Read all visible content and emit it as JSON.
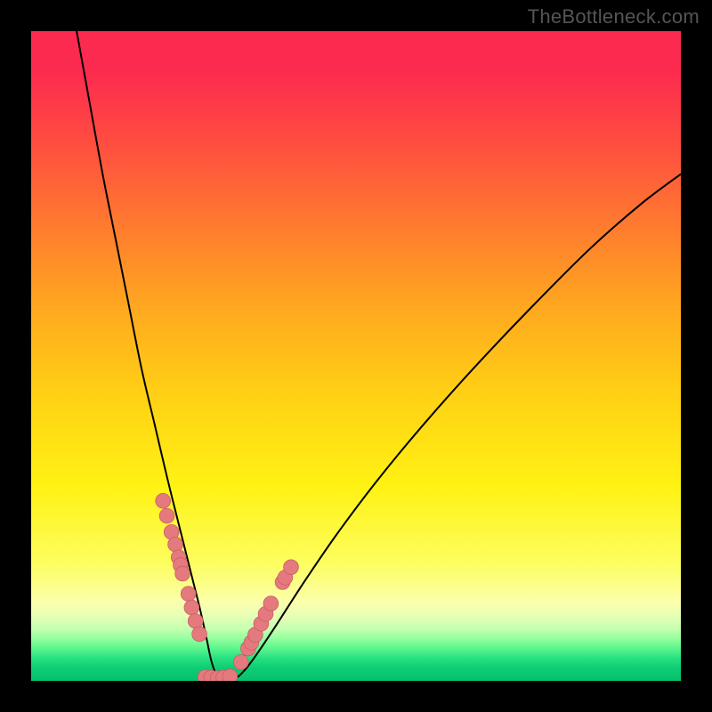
{
  "watermark": "TheBottleneck.com",
  "chart_data": {
    "type": "line",
    "title": "",
    "xlabel": "",
    "ylabel": "",
    "xlim": [
      0,
      100
    ],
    "ylim": [
      0,
      100
    ],
    "notes": "V-shaped curve on a vertical rainbow gradient. Minimum near x≈28, y≈0. Salmon dots cluster on both branches near the bottom.",
    "series": [
      {
        "name": "curve",
        "x": [
          7,
          9,
          11,
          13,
          15,
          17,
          19,
          21,
          23,
          24.5,
          26,
          27,
          27.7,
          28.4,
          29.3,
          30.3,
          31.5,
          33,
          35,
          38,
          42,
          47,
          53,
          60,
          68,
          77,
          86,
          94,
          100
        ],
        "y": [
          100,
          89,
          78,
          68,
          58,
          48,
          39.5,
          31,
          23,
          17,
          11,
          6.5,
          3.2,
          1.2,
          0.25,
          0.1,
          0.4,
          1.8,
          4.5,
          9,
          15.2,
          22.5,
          30.5,
          39,
          48,
          57.5,
          66.5,
          73.5,
          78
        ]
      },
      {
        "name": "dots-left",
        "x": [
          20.3,
          20.9,
          21.6,
          22.2,
          22.7,
          23.0,
          23.3,
          24.2,
          24.7,
          25.3,
          25.9
        ],
        "y": [
          27.7,
          25.4,
          22.9,
          21.0,
          19.0,
          17.8,
          16.5,
          13.4,
          11.3,
          9.2,
          7.2
        ]
      },
      {
        "name": "dots-right",
        "x": [
          32.3,
          33.4,
          33.9,
          34.5,
          35.4,
          36.1,
          36.9,
          38.7,
          39.1,
          40.0
        ],
        "y": [
          2.9,
          5.0,
          5.9,
          7.1,
          8.8,
          10.3,
          11.9,
          15.2,
          15.9,
          17.5
        ]
      },
      {
        "name": "dots-bottom",
        "x": [
          26.8,
          27.7,
          28.7,
          29.6,
          30.6
        ],
        "y": [
          0.6,
          0.5,
          0.4,
          0.5,
          0.7
        ]
      }
    ],
    "colors": {
      "curve": "#000000",
      "dots_fill": "#e47a7e",
      "dots_stroke": "#c75a62",
      "gradient_top": "#fd2a50",
      "gradient_bottom": "#07c06d"
    }
  }
}
